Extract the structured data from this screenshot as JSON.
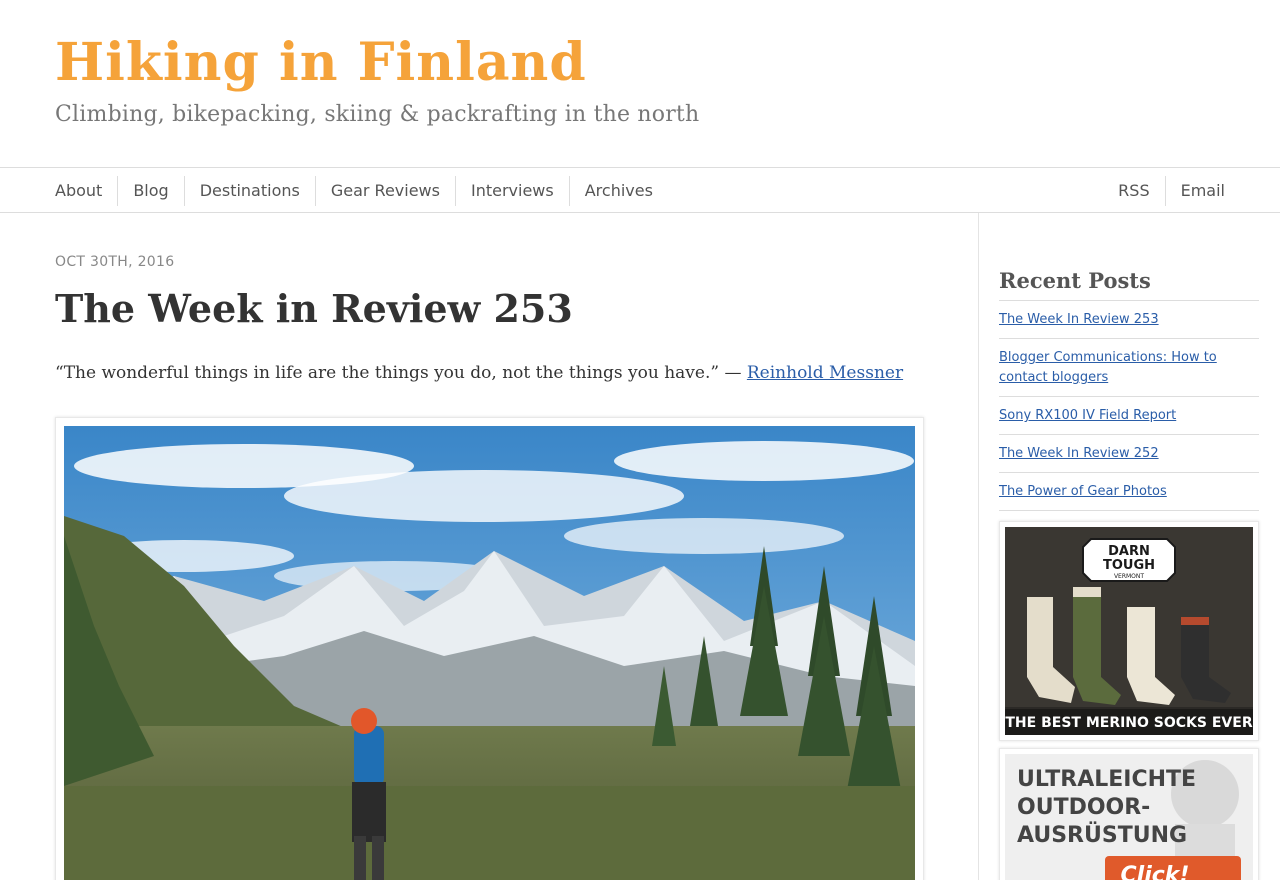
{
  "site": {
    "title": "Hiking in Finland",
    "tagline": "Climbing, bikepacking, skiing & packrafting in the north",
    "accent_color": "#f5a33a"
  },
  "nav": {
    "left": [
      "About",
      "Blog",
      "Destinations",
      "Gear Reviews",
      "Interviews",
      "Archives"
    ],
    "right": [
      "RSS",
      "Email"
    ]
  },
  "post": {
    "date": "OCT 30TH, 2016",
    "title": "The Week in Review 253",
    "quote": "“The wonderful things in life are the things you do, not the things you have.” — ",
    "quote_author": "Reinhold Messner",
    "link_color": "#2a5da8"
  },
  "sidebar": {
    "recent_heading": "Recent Posts",
    "recent_posts": [
      "The Week In Review 253",
      "Blogger Communications: How to contact bloggers",
      "Sony RX100 IV Field Report",
      "The Week In Review 252",
      "The Power of Gear Photos"
    ],
    "ad1": {
      "brand_line1": "DARN",
      "brand_line2": "TOUGH",
      "brand_line3": "VERMONT",
      "caption": "THE BEST MERINO SOCKS EVER"
    },
    "ad2": {
      "line1": "ULTRALEICHTE",
      "line2": "OUTDOOR-",
      "line3": "AUSRÜSTUNG",
      "button": "Click!"
    }
  }
}
